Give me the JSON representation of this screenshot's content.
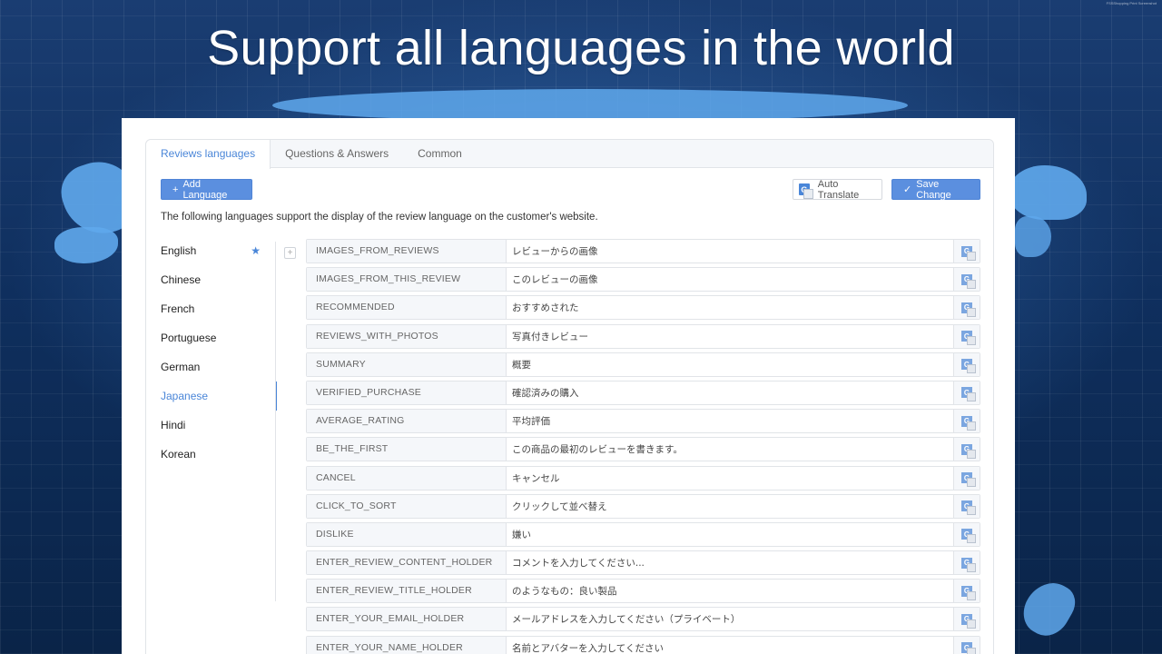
{
  "headline": "Support all languages in the world",
  "corner_text": "FSSShopping  Print Screenshot",
  "tabs": [
    {
      "label": "Reviews languages",
      "active": true
    },
    {
      "label": "Questions & Answers",
      "active": false
    },
    {
      "label": "Common",
      "active": false
    }
  ],
  "toolbar": {
    "add_language": "Add Language",
    "auto_translate": "Auto Translate",
    "save_change": "Save Change",
    "translate_icon_glyph": "G"
  },
  "description": "The following languages support the display of the review language on the customer's website.",
  "languages": [
    {
      "name": "English",
      "default": true
    },
    {
      "name": "Chinese"
    },
    {
      "name": "French"
    },
    {
      "name": "Portuguese"
    },
    {
      "name": "German"
    },
    {
      "name": "Japanese",
      "active": true
    },
    {
      "name": "Hindi"
    },
    {
      "name": "Korean"
    }
  ],
  "star_glyph": "★",
  "expand_glyph": "+",
  "rows": [
    {
      "key": "IMAGES_FROM_REVIEWS",
      "value": "レビューからの画像"
    },
    {
      "key": "IMAGES_FROM_THIS_REVIEW",
      "value": "このレビューの画像"
    },
    {
      "key": "RECOMMENDED",
      "value": "おすすめされた"
    },
    {
      "key": "REVIEWS_WITH_PHOTOS",
      "value": "写真付きレビュー"
    },
    {
      "key": "SUMMARY",
      "value": "概要"
    },
    {
      "key": "VERIFIED_PURCHASE",
      "value": "確認済みの購入"
    },
    {
      "key": "AVERAGE_RATING",
      "value": "平均評価"
    },
    {
      "key": "BE_THE_FIRST",
      "value": "この商品の最初のレビューを書きます。"
    },
    {
      "key": "CANCEL",
      "value": "キャンセル"
    },
    {
      "key": "CLICK_TO_SORT",
      "value": "クリックして並べ替え"
    },
    {
      "key": "DISLIKE",
      "value": "嫌い"
    },
    {
      "key": "ENTER_REVIEW_CONTENT_HOLDER",
      "value": "コメントを入力してください..."
    },
    {
      "key": "ENTER_REVIEW_TITLE_HOLDER",
      "value": "のようなもの：良い製品"
    },
    {
      "key": "ENTER_YOUR_EMAIL_HOLDER",
      "value": "メールアドレスを入力してください（プライベート）"
    },
    {
      "key": "ENTER_YOUR_NAME_HOLDER",
      "value": "名前とアバターを入力してください"
    }
  ],
  "colors": {
    "accent": "#4a86d8",
    "primary_button": "#5b8fdf",
    "background": "#0e2a52"
  }
}
